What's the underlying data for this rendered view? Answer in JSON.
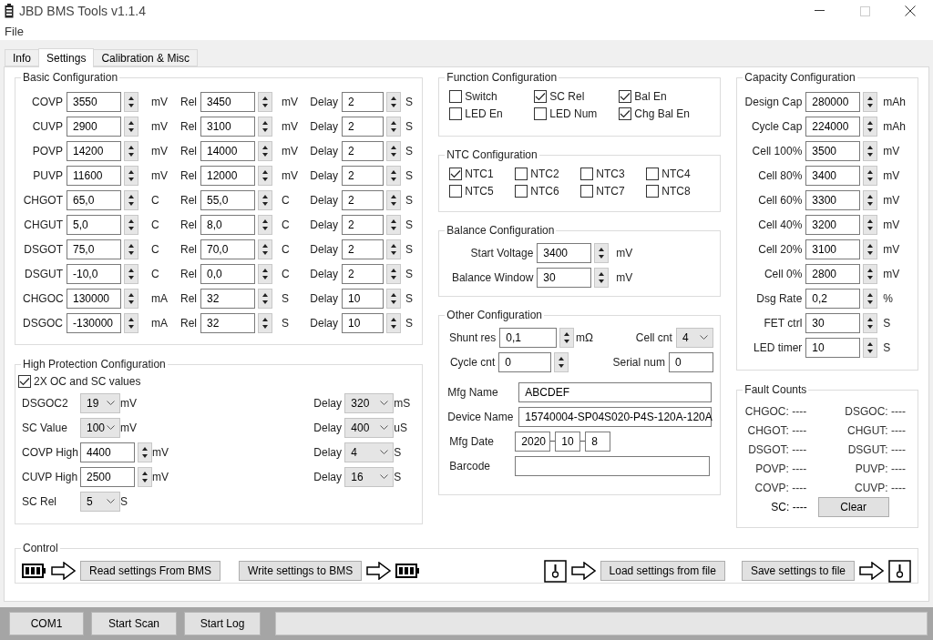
{
  "window": {
    "title": "JBD BMS Tools v1.1.4"
  },
  "menu": [
    "File"
  ],
  "tabs": [
    {
      "label": "Info",
      "selected": false
    },
    {
      "label": "Settings",
      "selected": true
    },
    {
      "label": "Calibration & Misc",
      "selected": false
    }
  ],
  "basic": {
    "title": "Basic Configuration",
    "rows": [
      {
        "label": "COVP",
        "value": "3550",
        "unit": "mV",
        "rel_label": "Rel",
        "rel_value": "3450",
        "rel_unit": "mV",
        "delay_label": "Delay",
        "delay_value": "2",
        "delay_unit": "S"
      },
      {
        "label": "CUVP",
        "value": "2900",
        "unit": "mV",
        "rel_label": "Rel",
        "rel_value": "3100",
        "rel_unit": "mV",
        "delay_label": "Delay",
        "delay_value": "2",
        "delay_unit": "S"
      },
      {
        "label": "POVP",
        "value": "14200",
        "unit": "mV",
        "rel_label": "Rel",
        "rel_value": "14000",
        "rel_unit": "mV",
        "delay_label": "Delay",
        "delay_value": "2",
        "delay_unit": "S"
      },
      {
        "label": "PUVP",
        "value": "11600",
        "unit": "mV",
        "rel_label": "Rel",
        "rel_value": "12000",
        "rel_unit": "mV",
        "delay_label": "Delay",
        "delay_value": "2",
        "delay_unit": "S"
      },
      {
        "label": "CHGOT",
        "value": "65,0",
        "unit": "C",
        "rel_label": "Rel",
        "rel_value": "55,0",
        "rel_unit": "C",
        "delay_label": "Delay",
        "delay_value": "2",
        "delay_unit": "S"
      },
      {
        "label": "CHGUT",
        "value": "5,0",
        "unit": "C",
        "rel_label": "Rel",
        "rel_value": "8,0",
        "rel_unit": "C",
        "delay_label": "Delay",
        "delay_value": "2",
        "delay_unit": "S"
      },
      {
        "label": "DSGOT",
        "value": "75,0",
        "unit": "C",
        "rel_label": "Rel",
        "rel_value": "70,0",
        "rel_unit": "C",
        "delay_label": "Delay",
        "delay_value": "2",
        "delay_unit": "S"
      },
      {
        "label": "DSGUT",
        "value": "-10,0",
        "unit": "C",
        "rel_label": "Rel",
        "rel_value": "0,0",
        "rel_unit": "C",
        "delay_label": "Delay",
        "delay_value": "2",
        "delay_unit": "S"
      },
      {
        "label": "CHGOC",
        "value": "130000",
        "unit": "mA",
        "rel_label": "Rel",
        "rel_value": "32",
        "rel_unit": "S",
        "delay_label": "Delay",
        "delay_value": "10",
        "delay_unit": "S"
      },
      {
        "label": "DSGOC",
        "value": "-130000",
        "unit": "mA",
        "rel_label": "Rel",
        "rel_value": "32",
        "rel_unit": "S",
        "delay_label": "Delay",
        "delay_value": "10",
        "delay_unit": "S"
      }
    ]
  },
  "high_protection": {
    "title": "High Protection Configuration",
    "option": {
      "label": "2X OC and SC values",
      "checked": true
    },
    "left": [
      {
        "label": "DSGOC2",
        "kind": "combo",
        "value": "19",
        "unit": "mV"
      },
      {
        "label": "SC Value",
        "kind": "combo",
        "value": "100",
        "unit": "mV"
      },
      {
        "label": "COVP High",
        "kind": "spin",
        "value": "4400",
        "unit": "mV"
      },
      {
        "label": "CUVP High",
        "kind": "spin",
        "value": "2500",
        "unit": "mV"
      },
      {
        "label": "SC Rel",
        "kind": "combo",
        "value": "5",
        "unit": "S"
      }
    ],
    "right": [
      {
        "label": "Delay",
        "value": "320",
        "unit": "mS"
      },
      {
        "label": "Delay",
        "value": "400",
        "unit": "uS"
      },
      {
        "label": "Delay",
        "value": "4",
        "unit": "S"
      },
      {
        "label": "Delay",
        "value": "16",
        "unit": "S"
      }
    ]
  },
  "function": {
    "title": "Function Configuration",
    "items": [
      {
        "label": "Switch",
        "checked": false
      },
      {
        "label": "SC Rel",
        "checked": true
      },
      {
        "label": "Bal En",
        "checked": true
      },
      {
        "label": "LED En",
        "checked": false
      },
      {
        "label": "LED Num",
        "checked": false
      },
      {
        "label": "Chg Bal En",
        "checked": true
      }
    ]
  },
  "ntc": {
    "title": "NTC Configuration",
    "items": [
      {
        "label": "NTC1",
        "checked": true
      },
      {
        "label": "NTC2",
        "checked": false
      },
      {
        "label": "NTC3",
        "checked": false
      },
      {
        "label": "NTC4",
        "checked": false
      },
      {
        "label": "NTC5",
        "checked": false
      },
      {
        "label": "NTC6",
        "checked": false
      },
      {
        "label": "NTC7",
        "checked": false
      },
      {
        "label": "NTC8",
        "checked": false
      }
    ]
  },
  "balance": {
    "title": "Balance Configuration",
    "rows": [
      {
        "label": "Start Voltage",
        "value": "3400",
        "unit": "mV"
      },
      {
        "label": "Balance Window",
        "value": "30",
        "unit": "mV"
      }
    ]
  },
  "other": {
    "title": "Other Configuration",
    "shunt": {
      "label": "Shunt res",
      "value": "0,1",
      "unit": "mΩ"
    },
    "cell_cnt": {
      "label": "Cell cnt",
      "value": "4"
    },
    "cycle": {
      "label": "Cycle cnt",
      "value": "0"
    },
    "serial": {
      "label": "Serial num",
      "value": "0"
    },
    "mfg_name": {
      "label": "Mfg Name",
      "value": "ABCDEF"
    },
    "device_name": {
      "label": "Device Name",
      "value": "15740004-SP04S020-P4S-120A-120A"
    },
    "mfg_date": {
      "label": "Mfg Date",
      "parts": [
        "2020",
        "10",
        "8"
      ]
    },
    "barcode": {
      "label": "Barcode"
    }
  },
  "capacity": {
    "title": "Capacity Configuration",
    "rows": [
      {
        "label": "Design Cap",
        "value": "280000",
        "unit": "mAh"
      },
      {
        "label": "Cycle Cap",
        "value": "224000",
        "unit": "mAh"
      },
      {
        "label": "Cell 100%",
        "value": "3500",
        "unit": "mV"
      },
      {
        "label": "Cell 80%",
        "value": "3400",
        "unit": "mV"
      },
      {
        "label": "Cell 60%",
        "value": "3300",
        "unit": "mV"
      },
      {
        "label": "Cell 40%",
        "value": "3200",
        "unit": "mV"
      },
      {
        "label": "Cell 20%",
        "value": "3100",
        "unit": "mV"
      },
      {
        "label": "Cell 0%",
        "value": "2800",
        "unit": "mV"
      },
      {
        "label": "Dsg Rate",
        "value": "0,2",
        "unit": "%"
      },
      {
        "label": "FET ctrl",
        "value": "30",
        "unit": "S"
      },
      {
        "label": "LED timer",
        "value": "10",
        "unit": "S"
      }
    ]
  },
  "fault": {
    "title": "Fault Counts",
    "items": [
      "CHGOC: ----",
      "DSGOC: ----",
      "CHGOT: ----",
      "CHGUT: ----",
      "DSGOT: ----",
      "DSGUT: ----",
      "POVP: ----",
      "PUVP: ----",
      "COVP: ----",
      "CUVP: ----"
    ],
    "sc": "SC: ----",
    "clear": "Clear"
  },
  "control": {
    "title": "Control",
    "read": "Read settings From BMS",
    "write": "Write settings to BMS",
    "load": "Load settings from file",
    "save": "Save settings to file"
  },
  "status_bar": {
    "buttons": [
      "COM1",
      "Start Scan",
      "Start Log"
    ]
  }
}
